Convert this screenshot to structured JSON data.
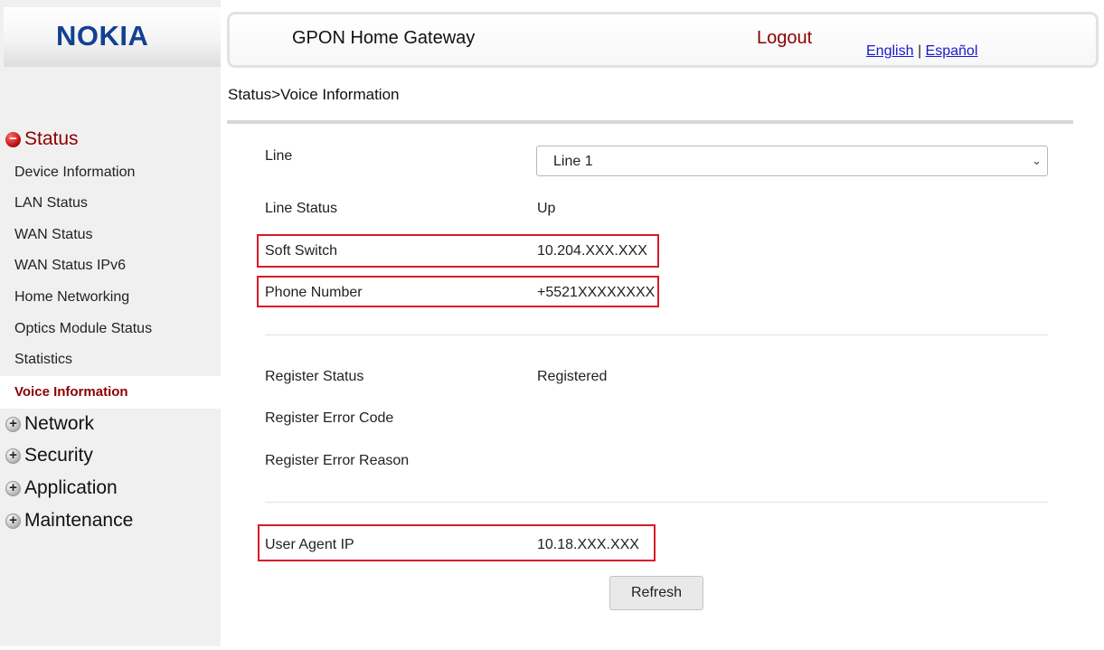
{
  "brand": {
    "logo_text": "NOKIA",
    "color": "#124191"
  },
  "header": {
    "title": "GPON Home Gateway",
    "logout_label": "Logout",
    "languages": [
      "English",
      "Español"
    ],
    "separator": "|"
  },
  "breadcrumb": "Status>Voice Information",
  "sidebar": {
    "status": {
      "label": "Status",
      "expanded": true,
      "items": [
        "Device Information",
        "LAN Status",
        "WAN Status",
        "WAN Status IPv6",
        "Home Networking",
        "Optics Module Status",
        "Statistics",
        "Voice Information"
      ],
      "active_item": "Voice Information"
    },
    "collapsed": [
      "Network",
      "Security",
      "Application",
      "Maintenance"
    ]
  },
  "form": {
    "line": {
      "label": "Line",
      "selected": "Line 1"
    },
    "line_status": {
      "label": "Line Status",
      "value": "Up"
    },
    "soft_switch": {
      "label": "Soft Switch",
      "value": "10.204.XXX.XXX"
    },
    "phone_number": {
      "label": "Phone Number",
      "value": "+5521XXXXXXXX"
    },
    "register_status": {
      "label": "Register Status",
      "value": "Registered"
    },
    "register_error_code": {
      "label": "Register Error Code",
      "value": ""
    },
    "register_error_reason": {
      "label": "Register Error Reason",
      "value": ""
    },
    "user_agent_ip": {
      "label": "User Agent IP",
      "value": "10.18.XXX.XXX"
    }
  },
  "refresh_label": "Refresh",
  "colors": {
    "active": "#8b0000",
    "highlight_box": "#d81b2a",
    "link": "#1a1acc"
  }
}
